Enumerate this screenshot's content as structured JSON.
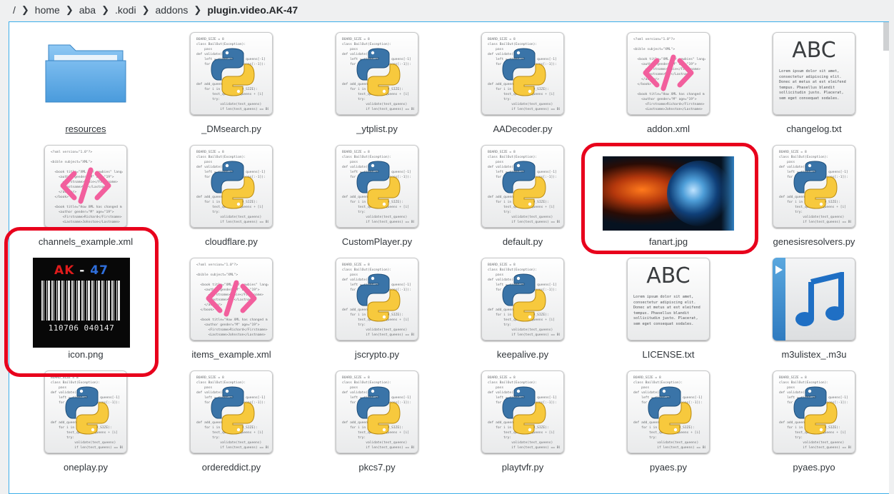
{
  "breadcrumb": {
    "root": "/",
    "segments": [
      "home",
      "aba",
      ".kodi",
      "addons"
    ],
    "current": "plugin.video.AK-47"
  },
  "files": [
    {
      "name": "resources",
      "type": "folder"
    },
    {
      "name": "_DMsearch.py",
      "type": "python"
    },
    {
      "name": "_ytplist.py",
      "type": "python"
    },
    {
      "name": "AADecoder.py",
      "type": "python"
    },
    {
      "name": "addon.xml",
      "type": "xml"
    },
    {
      "name": "changelog.txt",
      "type": "text"
    },
    {
      "name": "channels_example.xml",
      "type": "xml"
    },
    {
      "name": "cloudflare.py",
      "type": "python"
    },
    {
      "name": "CustomPlayer.py",
      "type": "python"
    },
    {
      "name": "default.py",
      "type": "python"
    },
    {
      "name": "fanart.jpg",
      "type": "image"
    },
    {
      "name": "genesisresolvers.py",
      "type": "python"
    },
    {
      "name": "icon.png",
      "type": "png"
    },
    {
      "name": "items_example.xml",
      "type": "xml"
    },
    {
      "name": "jscrypto.py",
      "type": "python"
    },
    {
      "name": "keepalive.py",
      "type": "python"
    },
    {
      "name": "LICENSE.txt",
      "type": "text"
    },
    {
      "name": "m3ulistex_.m3u",
      "type": "audio"
    },
    {
      "name": "oneplay.py",
      "type": "python"
    },
    {
      "name": "ordereddict.py",
      "type": "python"
    },
    {
      "name": "pkcs7.py",
      "type": "python"
    },
    {
      "name": "playtvfr.py",
      "type": "python"
    },
    {
      "name": "pyaes.py",
      "type": "python"
    },
    {
      "name": "pyaes.pyo",
      "type": "python"
    }
  ],
  "text_preview": {
    "heading": "ABC",
    "body": "Lorem ipsum dolor sit amet,\nconsectetur adipiscing elit.\nDonec at metus at est eleifend\ntempus. Phasellus blandit\nsollicitudin justo. Placerat,\nsem eget consequat sodales."
  },
  "icon_preview": {
    "logo_left": "AK",
    "logo_dash": " - ",
    "logo_right": "47",
    "digits": "110706 040147"
  },
  "highlighted": [
    "fanart.jpg",
    "icon.png",
    "channels_example.xml"
  ],
  "colors": {
    "accent": "#3daee9",
    "highlight_ring": "#e8001c",
    "python_blue": "#3a74a8",
    "python_yellow": "#f7c93d",
    "xml_pink": "#f25f9d"
  }
}
